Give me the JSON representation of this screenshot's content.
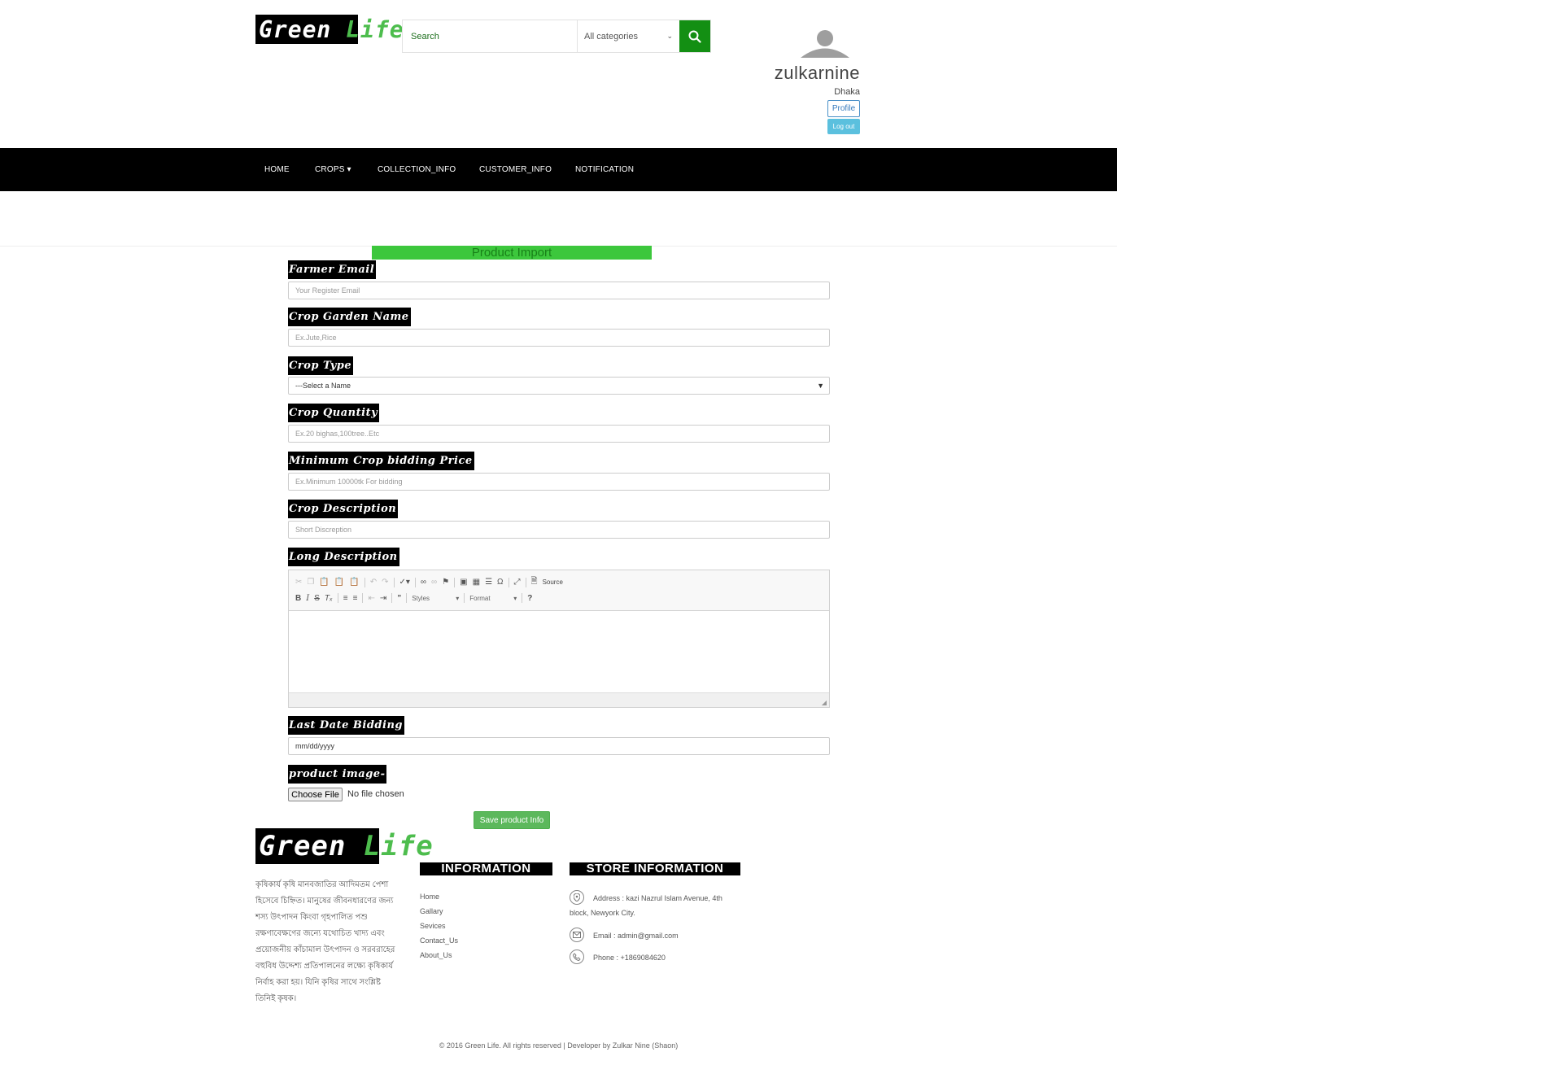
{
  "header": {
    "logo_green": "Green",
    "logo_life": "Life",
    "search_placeholder": "Search",
    "category_selected": "All categories",
    "user_name": "zulkarnine",
    "user_city": "Dhaka",
    "profile_label": "Profile",
    "logout_label": "Log out"
  },
  "nav": {
    "items": [
      {
        "label": "HOME"
      },
      {
        "label": "CROPS ▾"
      },
      {
        "label": "COLLECTION_INFO"
      },
      {
        "label": "CUSTOMER_INFO"
      },
      {
        "label": "NOTIFICATION"
      }
    ]
  },
  "form": {
    "title": "Product Import",
    "fields": [
      {
        "label": "Farmer Email",
        "placeholder": "Your Register Email"
      },
      {
        "label": "Crop Garden Name",
        "placeholder": "Ex.Jute,Rice"
      },
      {
        "label": "Crop Type",
        "placeholder": "---Select a Name"
      },
      {
        "label": "Crop Quantity",
        "placeholder": "Ex.20 bighas,100tree..Etc"
      },
      {
        "label": "Minimum Crop bidding Price",
        "placeholder": "Ex.Minimum 10000tk For bidding"
      },
      {
        "label": "Crop Description",
        "placeholder": "Short Discreption"
      },
      {
        "label": "Long Description",
        "placeholder": ""
      },
      {
        "label": "Last Date Bidding",
        "placeholder": "mm/dd/yyyy"
      },
      {
        "label": "product image-",
        "placeholder": ""
      }
    ],
    "editor": {
      "source_label": "Source",
      "styles_label": "Styles",
      "format_label": "Format"
    },
    "file_button": "Choose File",
    "file_status": "No file chosen",
    "save_label": "Save product Info"
  },
  "footer": {
    "logo_green": "Green",
    "logo_life": "Life",
    "about_text": "কৃষিকার্য কৃষি মানবজাতির আদিমতম পেশা হিসেবে চিহ্নিত। মানুষের জীবনধারণের জন্য শস্য উৎপাদন কিংবা গৃহপালিত পশু রক্ষণাবেক্ষণের জন্যে যথোচিত খাদ্য এবং প্রয়োজনীয় কাঁচামাল উৎপাদন ও সরবরাহের বহুবিধ উদ্দেশ্য প্রতিপালনের লক্ষ্যে কৃষিকার্য নির্বাহ করা হয়। যিনি কৃষির সাথে সংশ্লিষ্ট তিনিই কৃষক।",
    "info_heading": "INFORMATION",
    "info_links": [
      "Home",
      "Gallary",
      "Sevices",
      "Contact_Us",
      "About_Us"
    ],
    "store_heading": "STORE INFORMATION",
    "address_line1": "Address : kazi Nazrul Islam Avenue, 4th",
    "address_line2": "block, Newyork City.",
    "email": "Email : admin@gmail.com",
    "phone": "Phone : +1869084620",
    "copyright": "© 2016 Green Life. All rights reserved | Developer by Zulkar Nine (Shaon)"
  }
}
